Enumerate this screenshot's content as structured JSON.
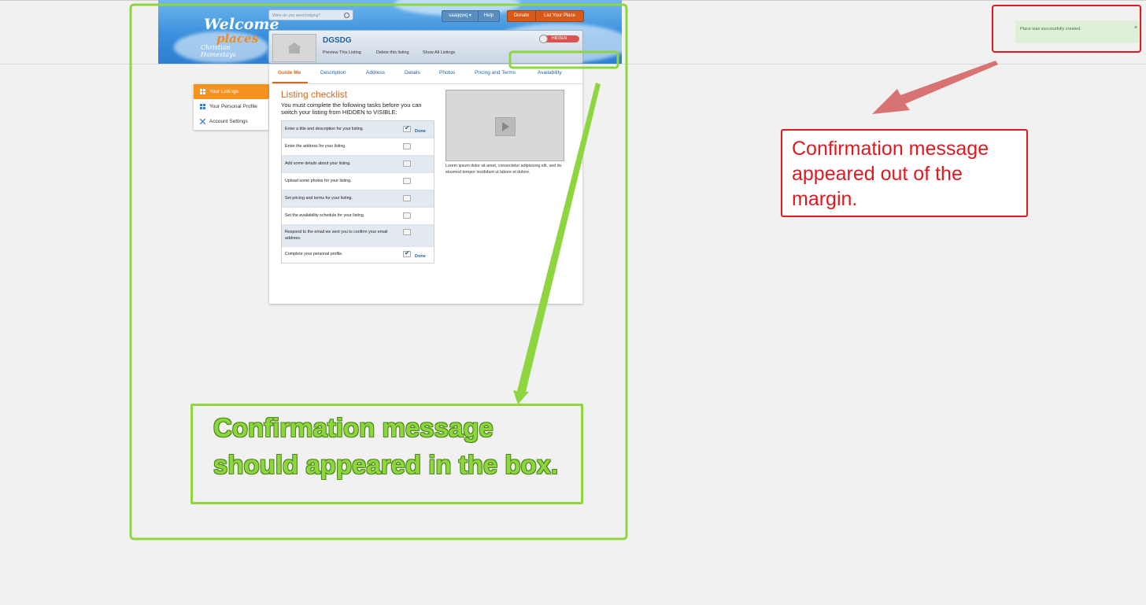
{
  "header": {
    "logo": {
      "line1": "Welcome",
      "line2": "places",
      "tagline": "Christian Homestays"
    },
    "search_placeholder": "Were do you need lodging?",
    "user_menu": "saaqqwq ▾",
    "help": "Help",
    "donate": "Donate",
    "list_place": "List Your Place"
  },
  "listing": {
    "title": "DGSDG",
    "links": [
      "Preview This Listing",
      "Delete this listing",
      "Show All Listings"
    ],
    "visibility": "HIDDEN"
  },
  "tabs": [
    "Guide Me",
    "Description",
    "Address",
    "Details",
    "Photos",
    "Pricing and Terms",
    "Availability"
  ],
  "active_tab": "Guide Me",
  "sidebar": {
    "items": [
      "Your Listings",
      "Your Personal Profile",
      "Account Settings"
    ],
    "active": "Your Listings"
  },
  "checklist": {
    "title": "Listing checklist",
    "intro": "You must complete the following tasks before you can switch your listing from HIDDEN to VISIBLE:",
    "items": [
      {
        "text": "Enter a title and description for your listing.",
        "checked": true,
        "status": "Done"
      },
      {
        "text": "Enter the address for your listing.",
        "checked": false,
        "status": ""
      },
      {
        "text": "Add some details about your listing.",
        "checked": false,
        "status": ""
      },
      {
        "text": "Upload some photos for your listing.",
        "checked": false,
        "status": ""
      },
      {
        "text": "Set pricing and terms for your listing.",
        "checked": false,
        "status": ""
      },
      {
        "text": "Set the availability schedule for your listing.",
        "checked": false,
        "status": ""
      },
      {
        "text": "Respond to the email we sent you to confirm your email address.",
        "checked": false,
        "status": ""
      },
      {
        "text": "Complete your personal profile.",
        "checked": true,
        "status": "Done"
      }
    ]
  },
  "video": {
    "caption": "Lorem ipsum dolor sit amet, consectetur adipisicing elit, sed do eiusmod tempor incididunt ut labore et dolore."
  },
  "toast": {
    "message": "Place was successfully created.",
    "close": "×"
  },
  "annotations": {
    "red_note": "Confirmation message appeared out of the margin.",
    "green_note": "Confirmation message should appeared in the box.",
    "red_color": "#e0191f",
    "green_color": "#8ed63f"
  }
}
